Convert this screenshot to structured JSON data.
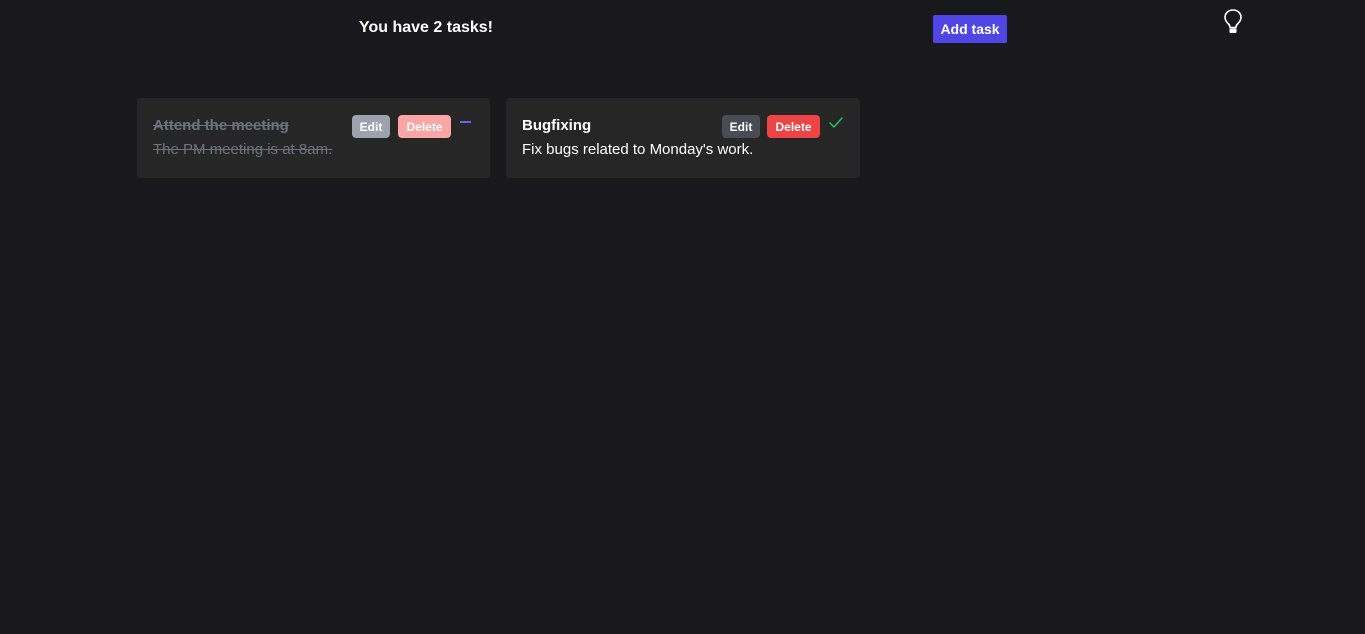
{
  "header": {
    "task_count_text": "You have 2 tasks!",
    "add_button_label": "Add task",
    "theme_icon": "lightbulb-icon"
  },
  "tasks": [
    {
      "title": "Attend the meeting",
      "description": "The PM meeting is at 8am.",
      "completed": true,
      "edit_label": "Edit",
      "delete_label": "Delete",
      "status_icon": "minus-icon"
    },
    {
      "title": "Bugfixing",
      "description": "Fix bugs related to Monday's work.",
      "completed": false,
      "edit_label": "Edit",
      "delete_label": "Delete",
      "status_icon": "check-icon"
    }
  ],
  "colors": {
    "background": "#19181d",
    "card_background": "#262626",
    "accent": "#4f46e5",
    "danger": "#ef4444",
    "success": "#22c55e"
  }
}
